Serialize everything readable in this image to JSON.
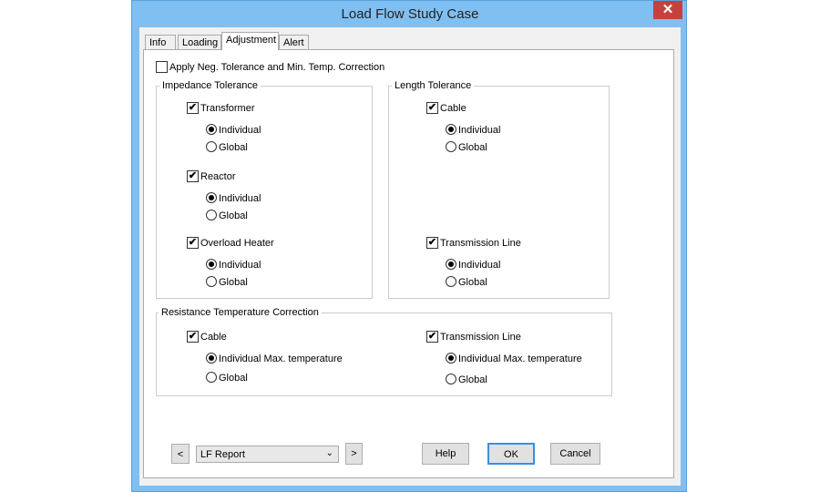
{
  "window": {
    "title": "Load Flow Study Case",
    "close": "✕"
  },
  "tabs": [
    "Info",
    "Loading",
    "Adjustment",
    "Alert"
  ],
  "active_tab": "Adjustment",
  "apply_neg": {
    "label": "Apply Neg. Tolerance and Min. Temp. Correction",
    "checked": false
  },
  "impedance": {
    "title": "Impedance Tolerance",
    "items": [
      {
        "label": "Transformer",
        "checked": true,
        "options": [
          "Individual",
          "Global"
        ],
        "selected": "Individual"
      },
      {
        "label": "Reactor",
        "checked": true,
        "options": [
          "Individual",
          "Global"
        ],
        "selected": "Individual"
      },
      {
        "label": "Overload Heater",
        "checked": true,
        "options": [
          "Individual",
          "Global"
        ],
        "selected": "Individual"
      }
    ]
  },
  "length": {
    "title": "Length Tolerance",
    "items": [
      {
        "label": "Cable",
        "checked": true,
        "options": [
          "Individual",
          "Global"
        ],
        "selected": "Individual"
      },
      {
        "label": "Transmission Line",
        "checked": true,
        "options": [
          "Individual",
          "Global"
        ],
        "selected": "Individual"
      }
    ]
  },
  "resistance": {
    "title": "Resistance Temperature Correction",
    "items": [
      {
        "label": "Cable",
        "checked": true,
        "options": [
          "Individual Max. temperature",
          "Global"
        ],
        "selected": "Individual Max. temperature"
      },
      {
        "label": "Transmission Line",
        "checked": true,
        "options": [
          "Individual Max. temperature",
          "Global"
        ],
        "selected": "Individual Max. temperature"
      }
    ]
  },
  "footer": {
    "prev": "<",
    "next": ">",
    "report": "LF Report",
    "help": "Help",
    "ok": "OK",
    "cancel": "Cancel"
  }
}
